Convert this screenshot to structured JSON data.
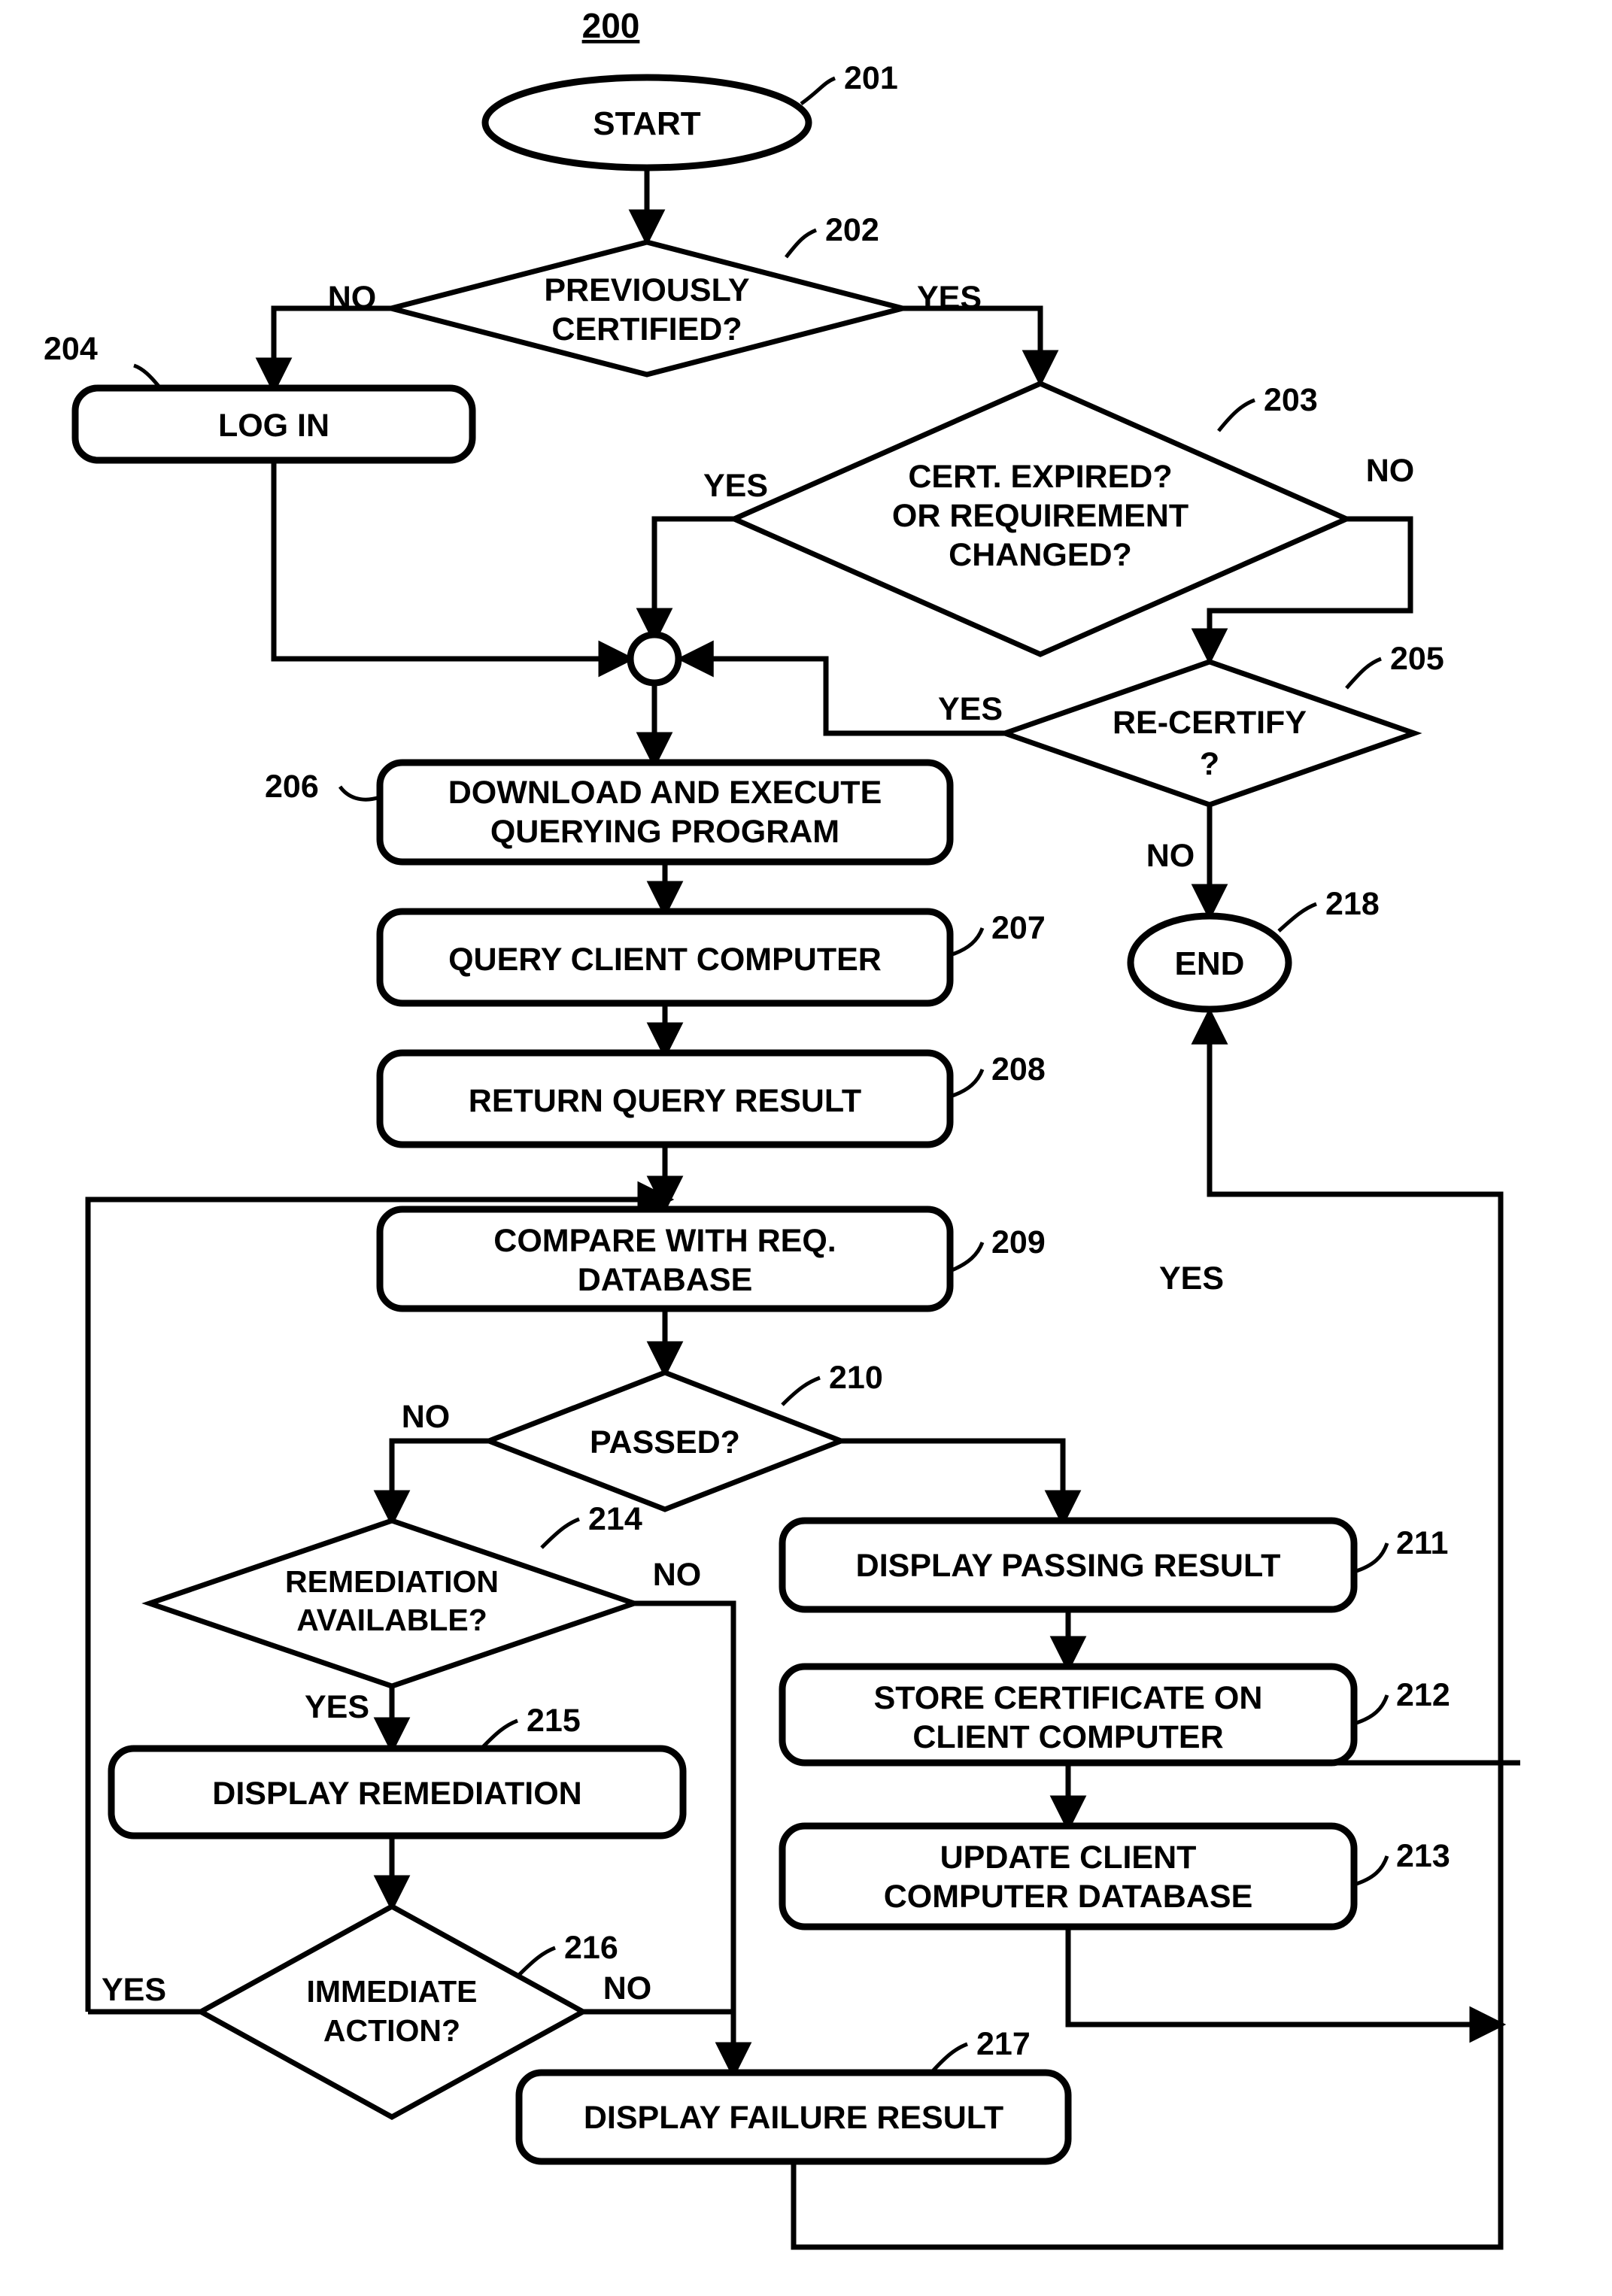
{
  "figure": {
    "number": "200",
    "type": "flowchart"
  },
  "nodes": {
    "start": {
      "ref": "201",
      "label": "START",
      "shape": "terminator"
    },
    "previously": {
      "ref": "202",
      "label_line1": "PREVIOUSLY",
      "label_line2": "CERTIFIED?",
      "shape": "decision"
    },
    "cert_expired": {
      "ref": "203",
      "label_line1": "CERT. EXPIRED?",
      "label_line2": "OR REQUIREMENT",
      "label_line3": "CHANGED?",
      "shape": "decision"
    },
    "log_in": {
      "ref": "204",
      "label": "LOG IN",
      "shape": "process"
    },
    "re_certify": {
      "ref": "205",
      "label_line1": "RE-CERTIFY",
      "label_line2": "?",
      "shape": "decision"
    },
    "download": {
      "ref": "206",
      "label_line1": "DOWNLOAD AND EXECUTE",
      "label_line2": "QUERYING PROGRAM",
      "shape": "process"
    },
    "query_client": {
      "ref": "207",
      "label": "QUERY CLIENT COMPUTER",
      "shape": "process"
    },
    "return_query": {
      "ref": "208",
      "label": "RETURN QUERY RESULT",
      "shape": "process"
    },
    "compare_req": {
      "ref": "209",
      "label_line1": "COMPARE WITH REQ.",
      "label_line2": "DATABASE",
      "shape": "process"
    },
    "passed": {
      "ref": "210",
      "label": "PASSED?",
      "shape": "decision"
    },
    "display_passing": {
      "ref": "211",
      "label": "DISPLAY PASSING RESULT",
      "shape": "process"
    },
    "store_cert": {
      "ref": "212",
      "label_line1": "STORE CERTIFICATE ON",
      "label_line2": "CLIENT COMPUTER",
      "shape": "process"
    },
    "update_client": {
      "ref": "213",
      "label_line1": "UPDATE CLIENT",
      "label_line2": "COMPUTER DATABASE",
      "shape": "process"
    },
    "remediation": {
      "ref": "214",
      "label_line1": "REMEDIATION",
      "label_line2": "AVAILABLE?",
      "shape": "decision"
    },
    "display_remed": {
      "ref": "215",
      "label": "DISPLAY REMEDIATION",
      "shape": "process"
    },
    "immediate": {
      "ref": "216",
      "label_line1": "IMMEDIATE",
      "label_line2": "ACTION?",
      "shape": "decision"
    },
    "display_failure": {
      "ref": "217",
      "label": "DISPLAY FAILURE RESULT",
      "shape": "process"
    },
    "end": {
      "ref": "218",
      "label": "END",
      "shape": "terminator"
    },
    "junction": {
      "ref": "",
      "label": "",
      "shape": "connector"
    }
  },
  "branch_labels": {
    "prev_no": "NO",
    "prev_yes": "YES",
    "cert_yes": "YES",
    "cert_no": "NO",
    "recert_yes": "YES",
    "recert_no": "NO",
    "passed_no": "NO",
    "passed_yes": "YES",
    "remed_no": "NO",
    "remed_yes": "YES",
    "immediate_yes": "YES",
    "immediate_no": "NO"
  },
  "colors": {
    "stroke": "#000000",
    "fill": "#ffffff"
  }
}
